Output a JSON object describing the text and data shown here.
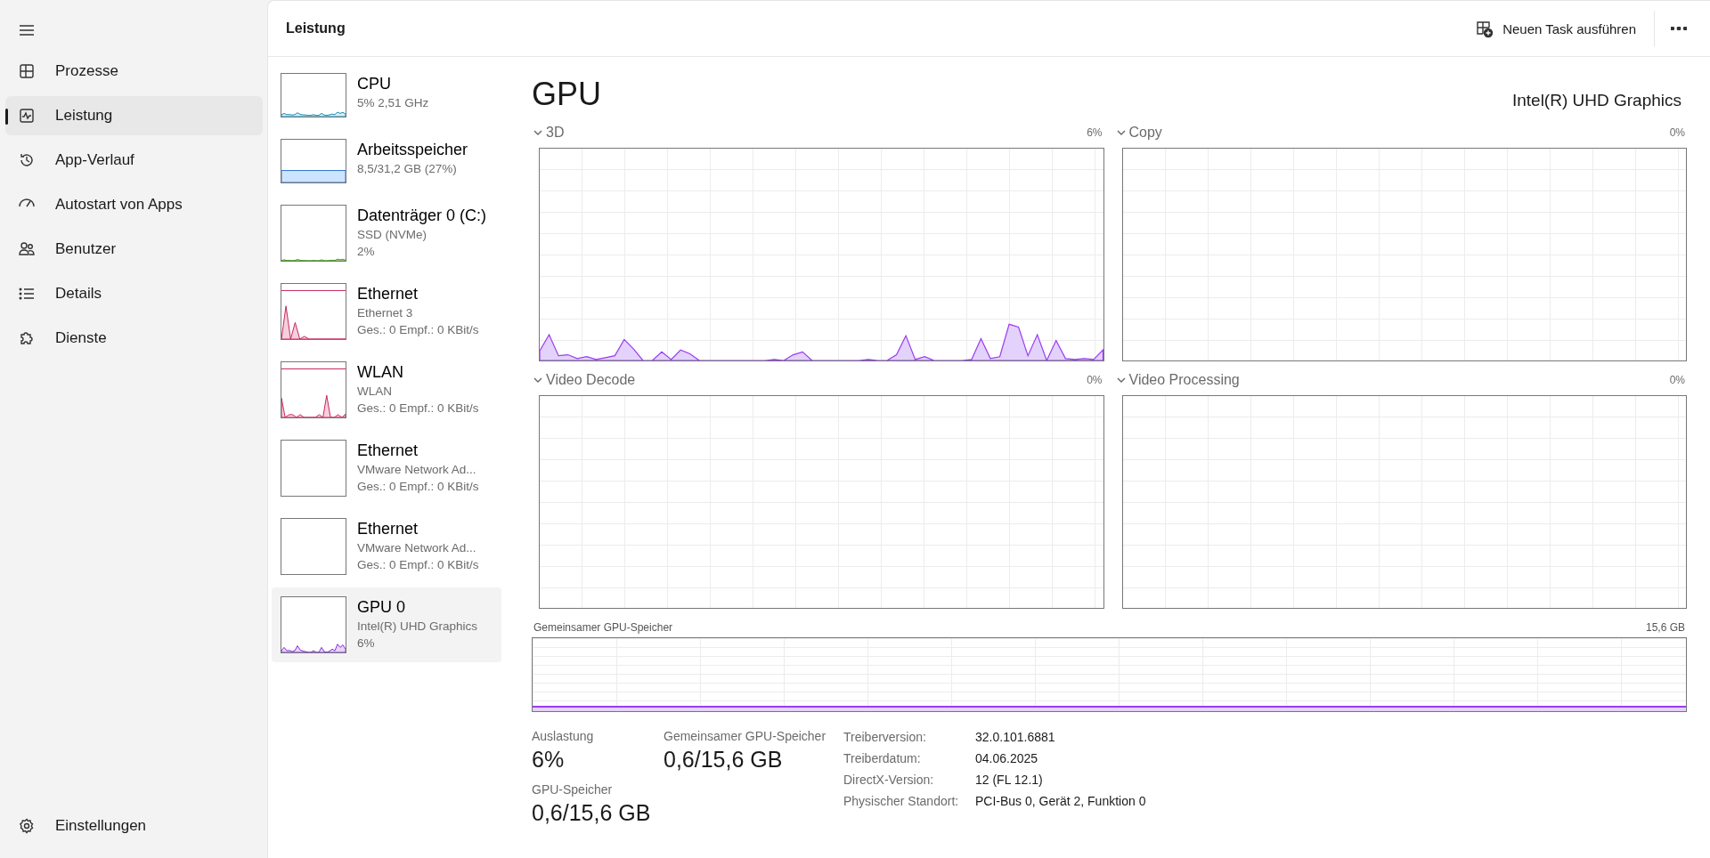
{
  "nav": {
    "items": [
      {
        "label": "Prozesse",
        "selected": false
      },
      {
        "label": "Leistung",
        "selected": true
      },
      {
        "label": "App-Verlauf",
        "selected": false
      },
      {
        "label": "Autostart von Apps",
        "selected": false
      },
      {
        "label": "Benutzer",
        "selected": false
      },
      {
        "label": "Details",
        "selected": false
      },
      {
        "label": "Dienste",
        "selected": false
      }
    ],
    "settings": "Einstellungen"
  },
  "header": {
    "title": "Leistung",
    "action": "Neuen Task ausführen"
  },
  "devices": [
    {
      "kind": "cpu",
      "name": "CPU",
      "lines": [
        "5%  2,51 GHz"
      ],
      "selected": false
    },
    {
      "kind": "memory",
      "name": "Arbeitsspeicher",
      "lines": [
        "8,5/31,2 GB (27%)"
      ],
      "selected": false
    },
    {
      "kind": "disk",
      "name": "Datenträger 0 (C:)",
      "lines": [
        "SSD (NVMe)",
        "2%"
      ],
      "selected": false
    },
    {
      "kind": "network",
      "name": "Ethernet",
      "lines": [
        "Ethernet 3",
        "Ges.: 0 Empf.: 0 KBit/s"
      ],
      "selected": false
    },
    {
      "kind": "wifi",
      "name": "WLAN",
      "lines": [
        "WLAN",
        "Ges.: 0 Empf.: 0 KBit/s"
      ],
      "selected": false
    },
    {
      "kind": "idle",
      "name": "Ethernet",
      "lines": [
        "VMware Network Ad...",
        "Ges.: 0 Empf.: 0 KBit/s"
      ],
      "selected": false
    },
    {
      "kind": "idle",
      "name": "Ethernet",
      "lines": [
        "VMware Network Ad...",
        "Ges.: 0 Empf.: 0 KBit/s"
      ],
      "selected": false
    },
    {
      "kind": "gpu",
      "name": "GPU 0",
      "lines": [
        "Intel(R) UHD Graphics",
        "6%"
      ],
      "selected": true
    }
  ],
  "detail": {
    "title": "GPU",
    "subtitle": "Intel(R) UHD Graphics",
    "engines": [
      {
        "label": "3D",
        "reading": "6%",
        "kind": "active"
      },
      {
        "label": "Copy",
        "reading": "0%",
        "kind": "idle"
      },
      {
        "label": "Video Decode",
        "reading": "0%",
        "kind": "idle"
      },
      {
        "label": "Video Processing",
        "reading": "0%",
        "kind": "idle"
      }
    ],
    "shared_memory": {
      "label": "Gemeinsamer GPU-Speicher",
      "reading": "15,6 GB"
    },
    "stats": [
      {
        "label": "Auslastung",
        "value": "6%"
      },
      {
        "label": "GPU-Speicher",
        "value": "0,6/15,6 GB"
      },
      {
        "label": "Gemeinsamer GPU-Speicher",
        "value": "0,6/15,6 GB"
      }
    ],
    "properties": [
      {
        "label": "Treiberversion:",
        "value": "32.0.101.6881"
      },
      {
        "label": "Treiberdatum:",
        "value": "04.06.2025"
      },
      {
        "label": "DirectX-Version:",
        "value": "12 (FL 12.1)"
      },
      {
        "label": "Physischer Standort:",
        "value": "PCI-Bus 0, Gerät 2, Funktion 0"
      }
    ]
  }
}
